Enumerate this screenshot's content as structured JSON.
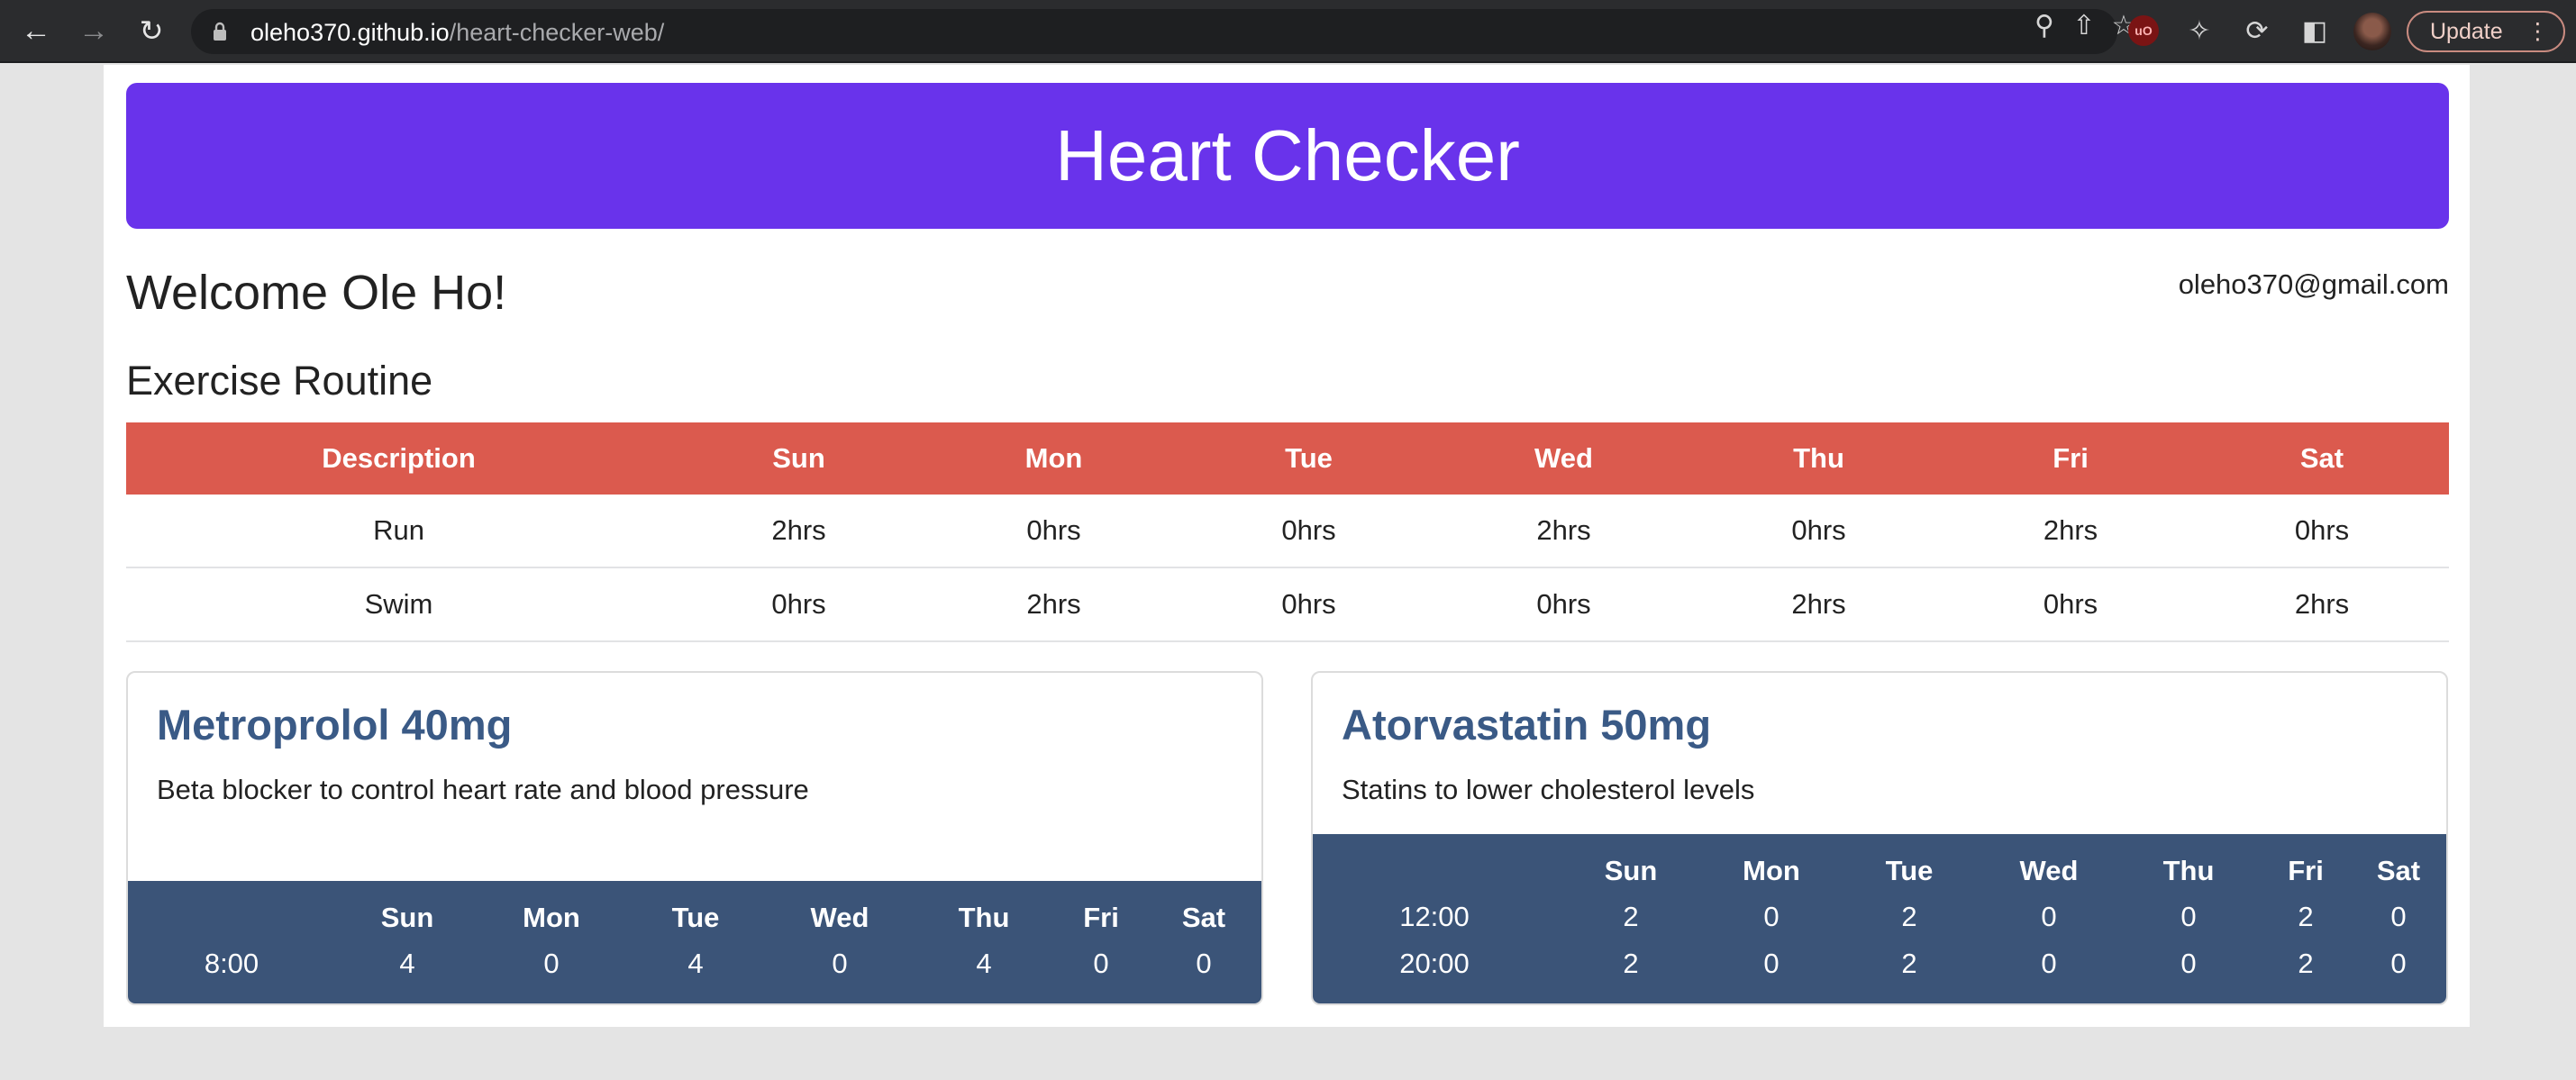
{
  "browser": {
    "url_host": "oleho370.github.io",
    "url_path": "/heart-checker-web/",
    "update_label": "Update"
  },
  "app": {
    "title": "Heart Checker",
    "welcome": "Welcome Ole Ho!",
    "email": "oleho370@gmail.com"
  },
  "exercise": {
    "title": "Exercise Routine",
    "headers": [
      "Description",
      "Sun",
      "Mon",
      "Tue",
      "Wed",
      "Thu",
      "Fri",
      "Sat"
    ],
    "rows": [
      [
        "Run",
        "2hrs",
        "0hrs",
        "0hrs",
        "2hrs",
        "0hrs",
        "2hrs",
        "0hrs"
      ],
      [
        "Swim",
        "0hrs",
        "2hrs",
        "0hrs",
        "0hrs",
        "2hrs",
        "0hrs",
        "2hrs"
      ]
    ]
  },
  "medications": [
    {
      "name": "Metroprolol 40mg",
      "description": "Beta blocker to control heart rate and blood pressure",
      "headers": [
        "",
        "Sun",
        "Mon",
        "Tue",
        "Wed",
        "Thu",
        "Fri",
        "Sat"
      ],
      "rows": [
        [
          "8:00",
          "4",
          "0",
          "4",
          "0",
          "4",
          "0",
          "0"
        ]
      ]
    },
    {
      "name": "Atorvastatin 50mg",
      "description": "Statins to lower cholesterol levels",
      "headers": [
        "",
        "Sun",
        "Mon",
        "Tue",
        "Wed",
        "Thu",
        "Fri",
        "Sat"
      ],
      "rows": [
        [
          "12:00",
          "2",
          "0",
          "2",
          "0",
          "0",
          "2",
          "0"
        ],
        [
          "20:00",
          "2",
          "0",
          "2",
          "0",
          "0",
          "2",
          "0"
        ]
      ]
    }
  ],
  "colors": {
    "banner": "#6933eb",
    "table_header": "#db5a4e",
    "med_title": "#3a5a86",
    "schedule_bg": "#3b5478"
  }
}
